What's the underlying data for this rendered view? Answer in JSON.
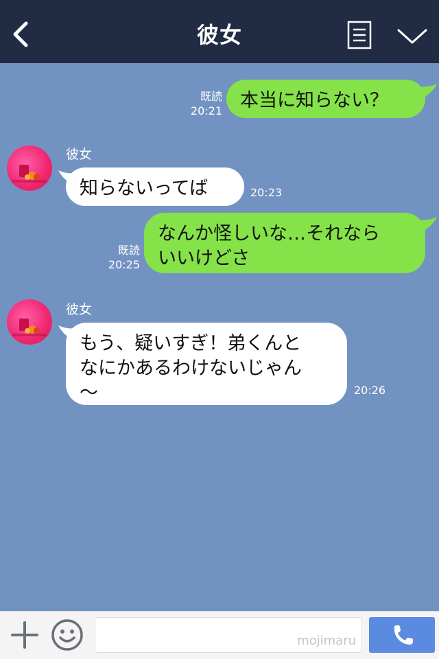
{
  "header": {
    "title": "彼女"
  },
  "messages": [
    {
      "side": "me",
      "text_lines": [
        "本当に知らない？"
      ],
      "read": "既読",
      "time": "20:21"
    },
    {
      "side": "them",
      "sender": "彼女",
      "text_lines": [
        "知らないってば"
      ],
      "time": "20:23"
    },
    {
      "side": "me",
      "text_lines": [
        "なんか怪しいな…それなら",
        "いいけどさ"
      ],
      "read": "既読",
      "time": "20:25"
    },
    {
      "side": "them",
      "sender": "彼女",
      "text_lines": [
        "もう、疑いすぎ！弟くんと",
        "なにかあるわけないじゃん",
        "〜"
      ],
      "time": "20:26"
    }
  ],
  "input": {
    "watermark": "mojimaru"
  },
  "colors": {
    "header_bg": "#222b44",
    "chat_bg": "#7293c2",
    "me_bubble": "#85e249",
    "them_bubble": "#ffffff",
    "call_button": "#5b8be0"
  },
  "icons": {
    "back": "chevron-left-icon",
    "menu": "menu-list-icon",
    "collapse": "chevron-down-icon",
    "add": "plus-icon",
    "emoji": "smiley-icon",
    "call": "phone-icon"
  }
}
